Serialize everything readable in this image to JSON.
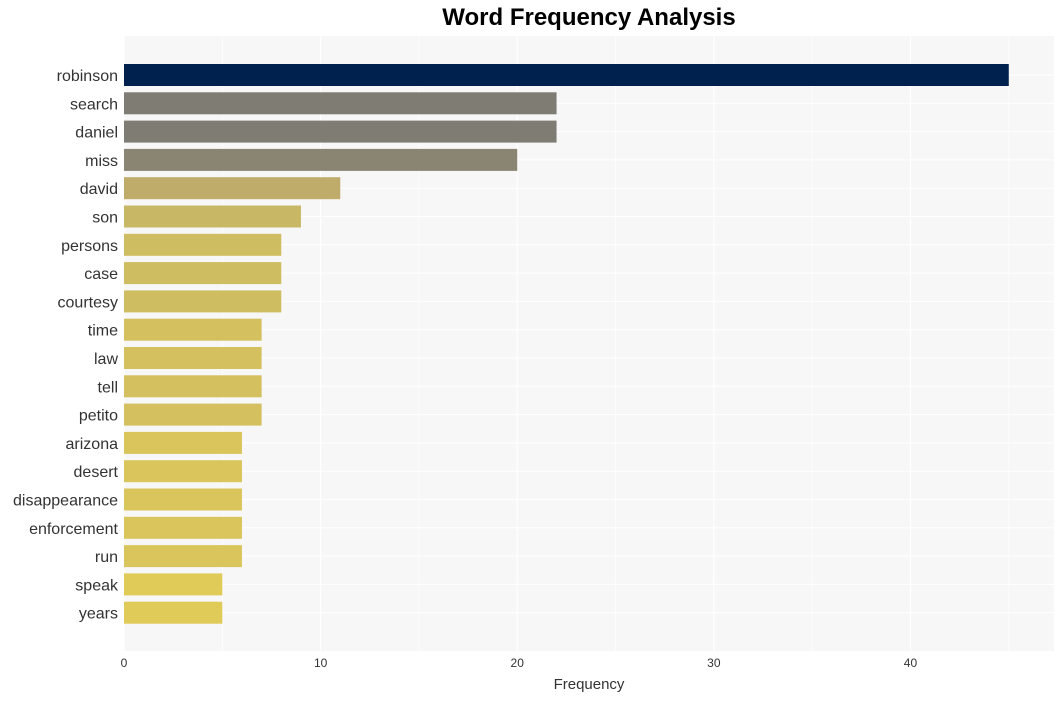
{
  "chart_data": {
    "type": "bar",
    "orientation": "horizontal",
    "title": "Word Frequency Analysis",
    "xlabel": "Frequency",
    "ylabel": "",
    "xlim": [
      0,
      47.3
    ],
    "xticks": [
      0,
      10,
      20,
      30,
      40
    ],
    "grid": true,
    "legend": "none",
    "categories": [
      "robinson",
      "search",
      "daniel",
      "miss",
      "david",
      "son",
      "persons",
      "case",
      "courtesy",
      "time",
      "law",
      "tell",
      "petito",
      "arizona",
      "desert",
      "disappearance",
      "enforcement",
      "run",
      "speak",
      "years"
    ],
    "values": [
      45,
      22,
      22,
      20,
      11,
      9,
      8,
      8,
      8,
      7,
      7,
      7,
      7,
      6,
      6,
      6,
      6,
      6,
      5,
      5
    ],
    "colors": [
      "#00214d",
      "#7f7c74",
      "#7f7c74",
      "#8a8472",
      "#bfab6a",
      "#c8b865",
      "#cfbd62",
      "#cfbd62",
      "#cfbd62",
      "#d4c05e",
      "#d4c05e",
      "#d4c05e",
      "#d4c05e",
      "#dac55c",
      "#dac55c",
      "#dac55c",
      "#dac55c",
      "#dac55c",
      "#e0ca58",
      "#e0ca58"
    ]
  }
}
